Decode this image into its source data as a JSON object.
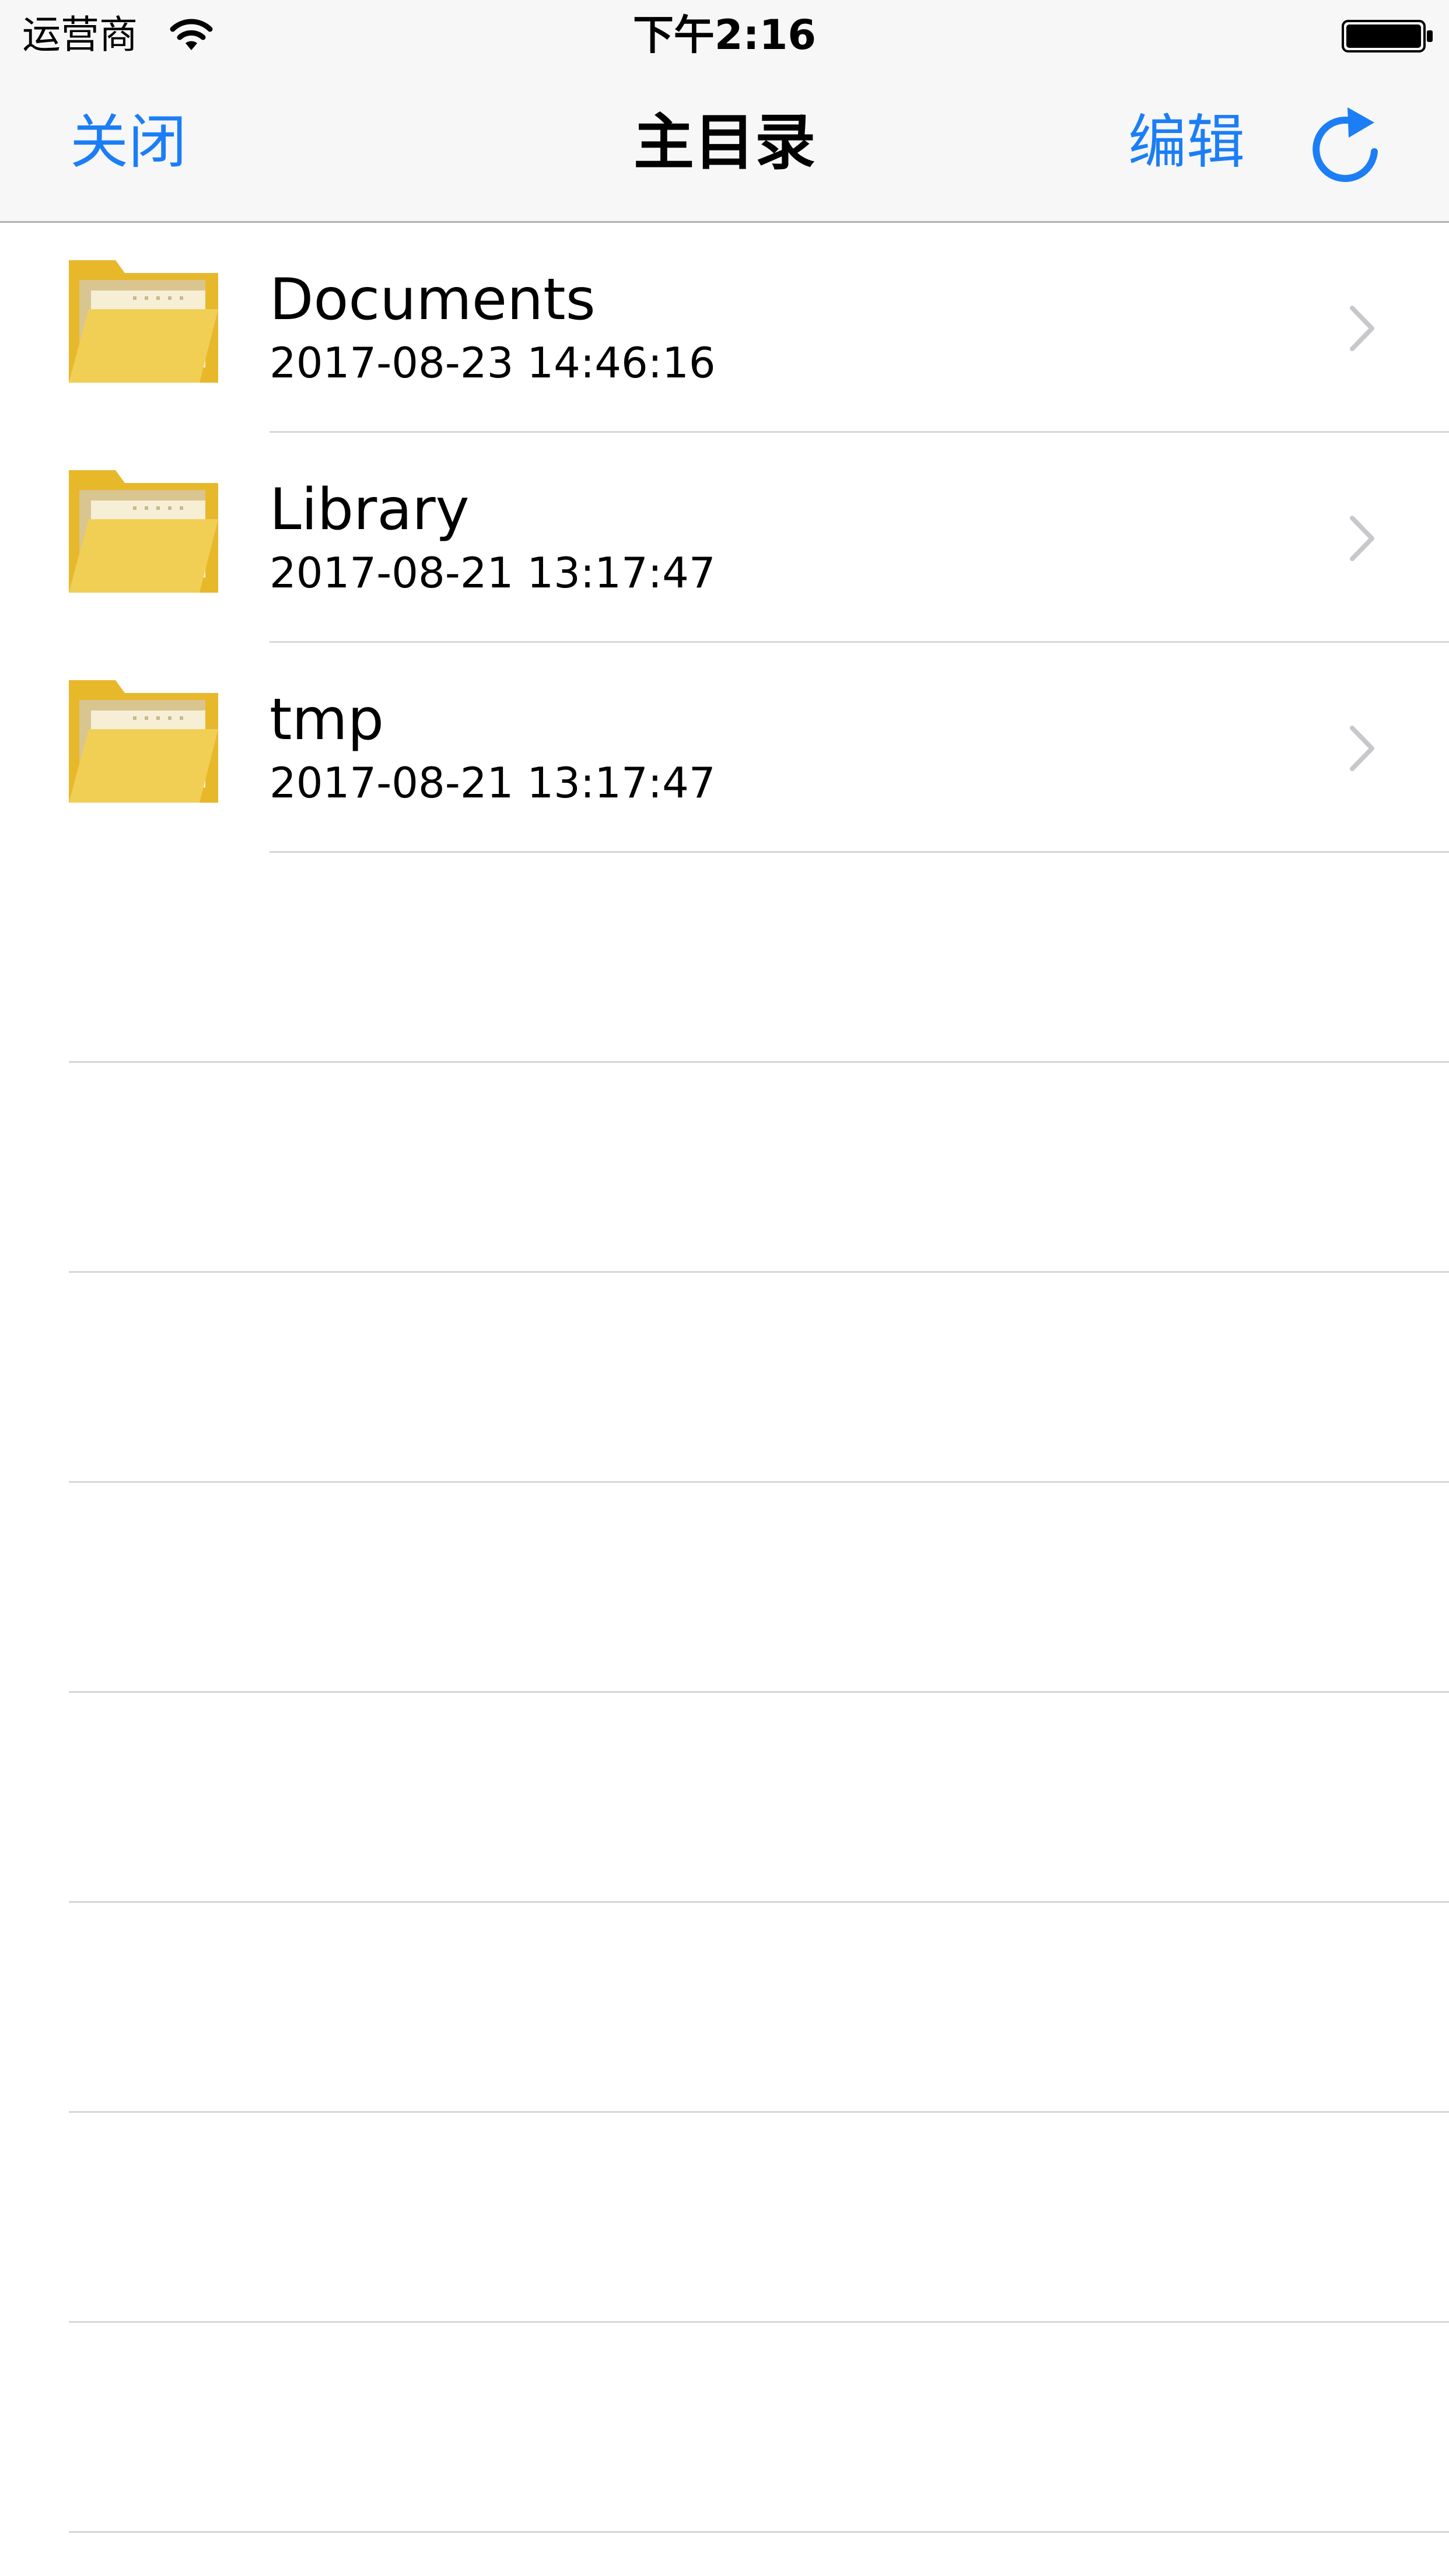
{
  "status_bar": {
    "carrier": "运营商",
    "time": "下午2:16",
    "wifi_icon": "wifi-icon",
    "battery_icon": "battery-full-icon"
  },
  "nav": {
    "close_label": "关闭",
    "title": "主目录",
    "edit_label": "编辑",
    "refresh_icon": "refresh-icon",
    "tint_color": "#1b7ef5"
  },
  "files": [
    {
      "name": "Documents",
      "date": "2017-08-23 14:46:16",
      "icon": "folder-icon"
    },
    {
      "name": "Library",
      "date": "2017-08-21 13:17:47",
      "icon": "folder-icon"
    },
    {
      "name": "tmp",
      "date": "2017-08-21 13:17:47",
      "icon": "folder-icon"
    }
  ],
  "colors": {
    "folder_front": "#f1cf55",
    "folder_back": "#e8b82b",
    "separator": "#d6d6d9",
    "chevron": "#c7c7cc"
  }
}
